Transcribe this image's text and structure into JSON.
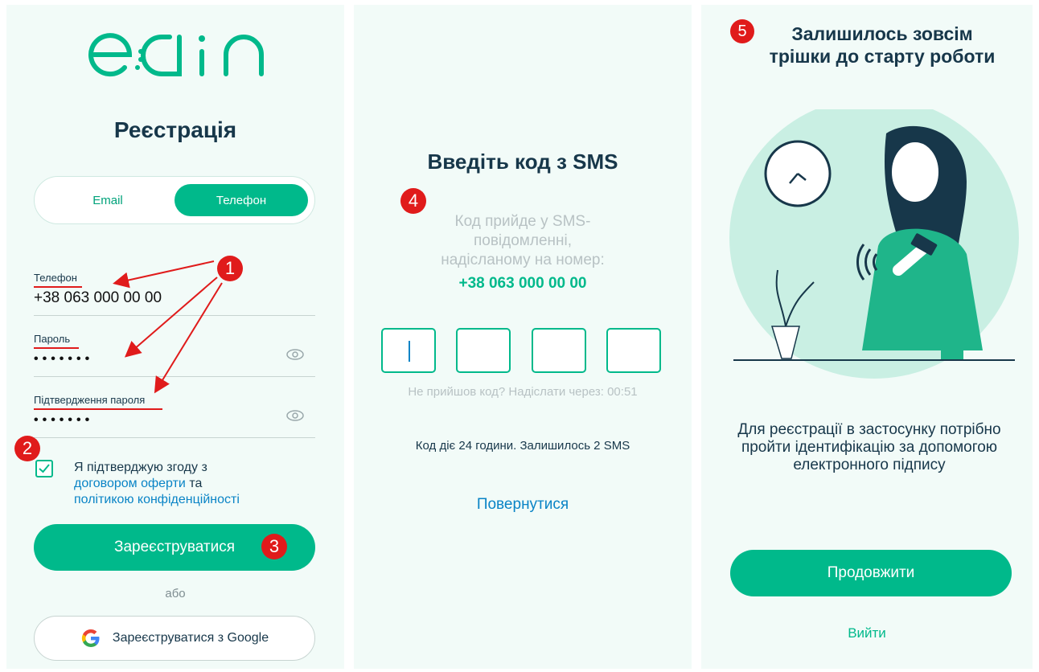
{
  "register": {
    "title": "Реєстрація",
    "tabs": [
      {
        "label": "Email",
        "active": false
      },
      {
        "label": "Телефон",
        "active": true
      }
    ],
    "phone_label": "Телефон",
    "phone_value": "+38 063 000 00 00",
    "password_label": "Пароль",
    "password_value": "•••••••",
    "confirm_label": "Підтвердження пароля",
    "confirm_value": "•••••••",
    "agree_prefix": "Я підтверджую згоду з",
    "offer_link": "договором оферти",
    "agree_and": "та",
    "privacy_link": "політикою конфіденційності",
    "agree_checked": true,
    "submit_label": "Зареєструватися",
    "or_label": "або",
    "google_label": "Зареєструватися з Google"
  },
  "sms": {
    "title": "Введіть код з SMS",
    "desc_line1": "Код прийде у SMS-",
    "desc_line2": "повідомленні,",
    "desc_line3": "надісланому на номер:",
    "phone": "+38 063 000 00 00",
    "resend_text": "Не прийшов код? Надіслати через: 00:51",
    "validity": "Код діє 24 години. Залишилось 2 SMS",
    "back_label": "Повернутися"
  },
  "final": {
    "title_line1": "Залишилось зовсім",
    "title_line2": "трішки до старту роботи",
    "desc": "Для реєстрації в застосунку потрібно пройти ідентифікацію за допомогою електронного підпису",
    "continue_label": "Продовжити",
    "logout_label": "Вийти"
  },
  "badges": [
    "1",
    "2",
    "3",
    "4",
    "5"
  ],
  "colors": {
    "accent": "#00b98b",
    "dark": "#17374a",
    "link": "#0a84c6",
    "annotation": "#e01b1b",
    "panel_bg": "#f2fbf8"
  }
}
